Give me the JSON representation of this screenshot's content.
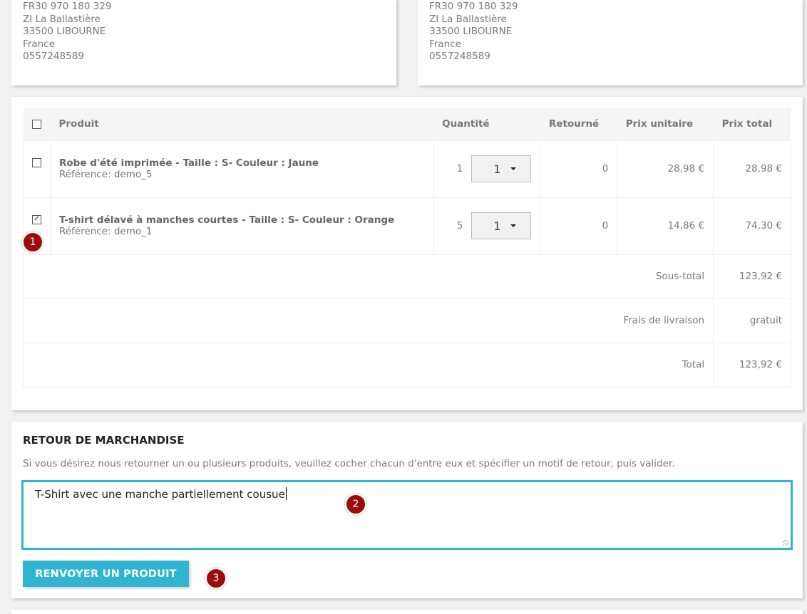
{
  "addresses": [
    {
      "lines": [
        "FR30 970 180 329",
        "ZI La Ballastière",
        "33500 LIBOURNE",
        "France",
        "0557248589"
      ]
    },
    {
      "lines": [
        "FR30 970 180 329",
        "ZI La Ballastière",
        "33500 LIBOURNE",
        "France",
        "0557248589"
      ]
    }
  ],
  "table": {
    "headers": {
      "product": "Produit",
      "quantity": "Quantité",
      "returned": "Retourné",
      "unit_price": "Prix unitaire",
      "total_price": "Prix total"
    },
    "rows": [
      {
        "checked": false,
        "name": "Robe d'été imprimée - Taille : S- Couleur : Jaune",
        "reference": "Référence: demo_5",
        "quantity": "1",
        "return_qty": "1",
        "returned": "0",
        "unit_price": "28,98 €",
        "total_price": "28,98 €"
      },
      {
        "checked": true,
        "name": "T-shirt délavé à manches courtes - Taille : S- Couleur : Orange",
        "reference": "Référence: demo_1",
        "quantity": "5",
        "return_qty": "1",
        "returned": "0",
        "unit_price": "14,86 €",
        "total_price": "74,30 €"
      }
    ],
    "summary": [
      {
        "label": "Sous-total",
        "value": "123,92 €"
      },
      {
        "label": "Frais de livraison",
        "value": "gratuit"
      },
      {
        "label": "Total",
        "value": "123,92 €"
      }
    ]
  },
  "merchandise_return": {
    "title": "RETOUR DE MARCHANDISE",
    "instructions": "Si vous désirez nous retourner un ou plusieurs produits, veuillez cocher chacun d'entre eux et spécifier un motif de retour, puis valider.",
    "reason_value": "T-Shirt avec une manche partiellement cousue",
    "submit_label": "RENVOYER UN PRODUIT"
  },
  "annotations": [
    "1",
    "2",
    "3"
  ],
  "colors": {
    "accent": "#2fb5d2",
    "badge": "#9b0d0d"
  }
}
